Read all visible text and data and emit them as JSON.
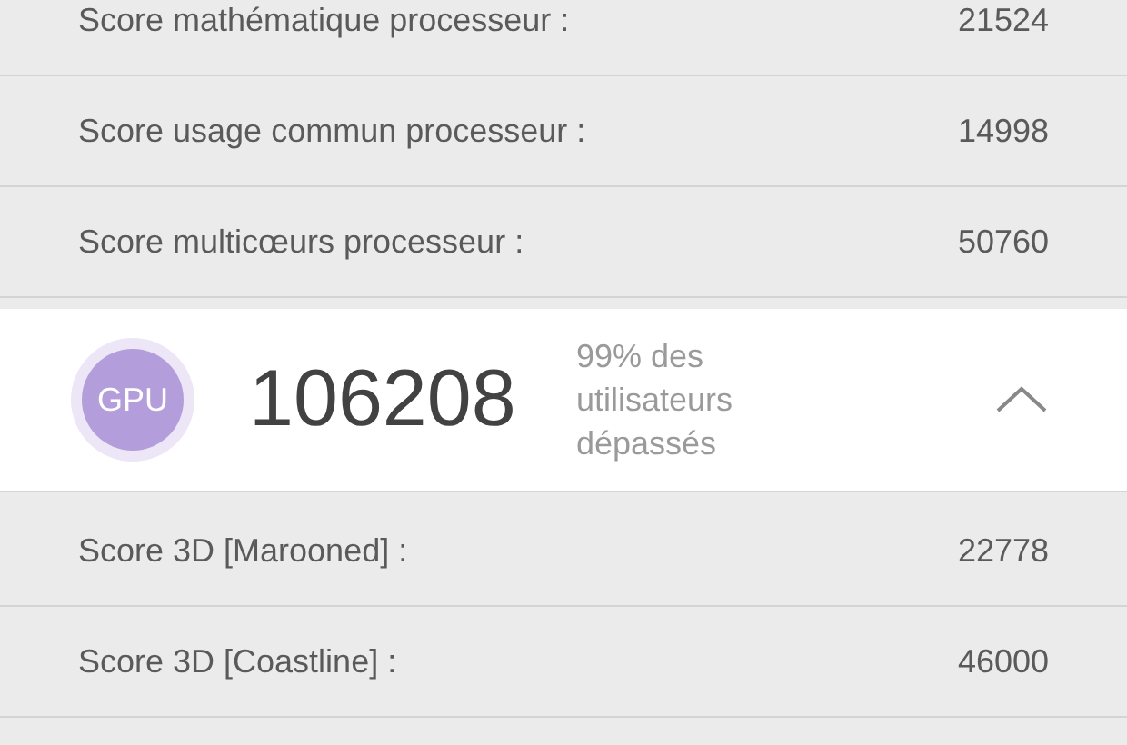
{
  "cpu_scores": [
    {
      "label": "Score mathématique processeur :",
      "value": "21524"
    },
    {
      "label": "Score usage commun processeur :",
      "value": "14998"
    },
    {
      "label": "Score multicœurs processeur :",
      "value": "50760"
    }
  ],
  "gpu": {
    "badge": "GPU",
    "score": "106208",
    "percentile": "99% des utilisateurs dépassés",
    "expanded": true
  },
  "gpu_scores": [
    {
      "label": "Score 3D [Marooned] :",
      "value": "22778"
    },
    {
      "label": "Score 3D [Coastline] :",
      "value": "46000"
    }
  ]
}
